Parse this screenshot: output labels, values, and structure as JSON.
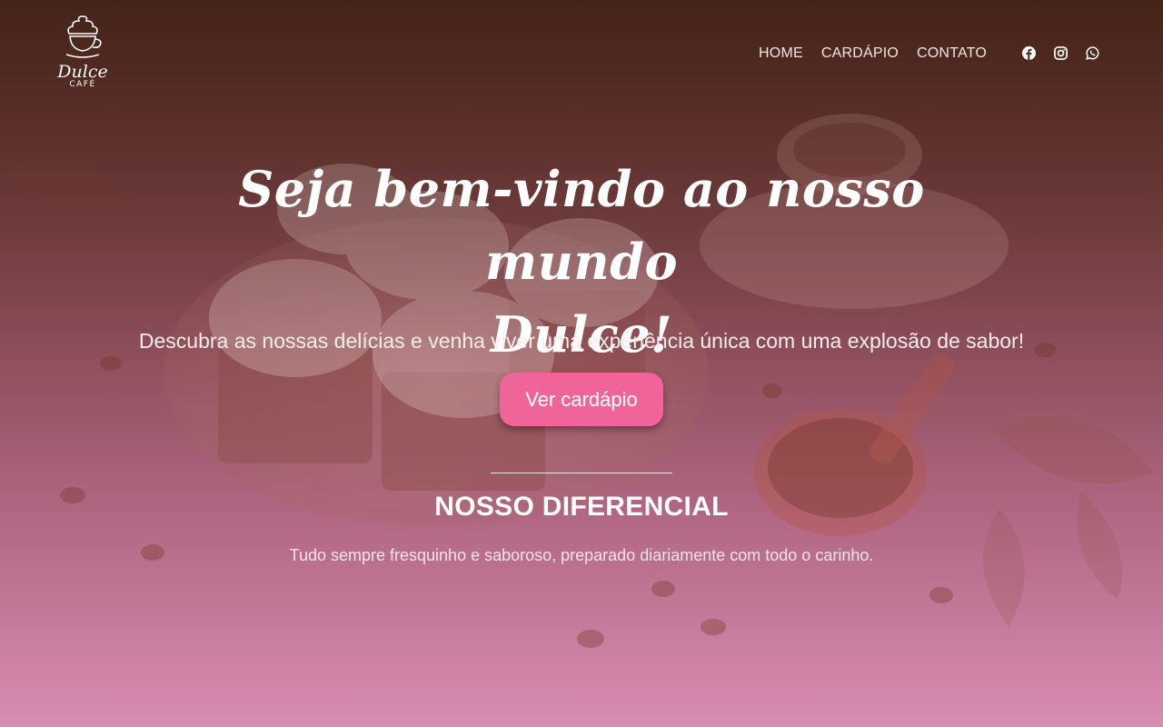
{
  "brand": {
    "name": "Dulce",
    "sub": "CAFÉ"
  },
  "nav": {
    "items": [
      {
        "label": "HOME"
      },
      {
        "label": "CARDÁPIO"
      },
      {
        "label": "CONTATO"
      }
    ]
  },
  "social": [
    {
      "icon": "facebook-icon"
    },
    {
      "icon": "instagram-icon"
    },
    {
      "icon": "whatsapp-icon"
    }
  ],
  "hero": {
    "headline_line1": "Seja bem-vindo ao nosso mundo",
    "headline_line2": "Dulce!",
    "tagline": "Descubra as nossas delícias e venha viver uma experiência única com uma explosão de sabor!",
    "cta_label": "Ver cardápio"
  },
  "differential": {
    "title": "NOSSO DIFERENCIAL",
    "text": "Tudo sempre fresquinho e saboroso, preparado diariamente com todo o carinho."
  },
  "colors": {
    "accent": "#f0649a",
    "header_brown": "#4e2a1e",
    "pink_bottom": "#d98cb2"
  }
}
